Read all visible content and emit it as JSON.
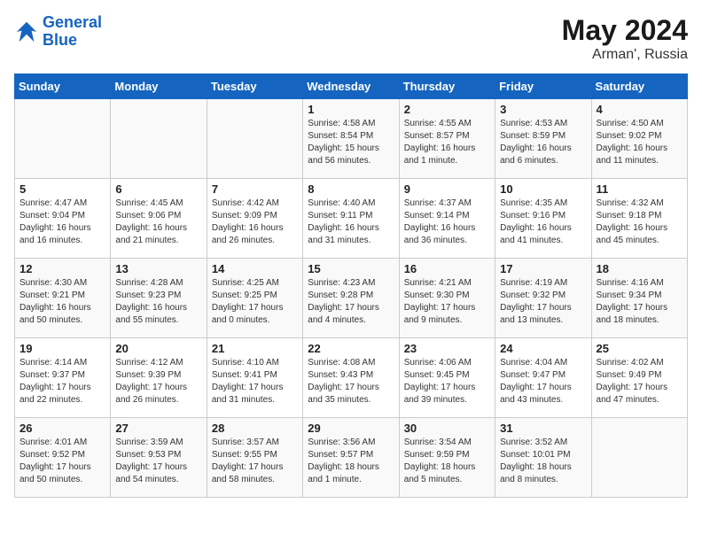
{
  "header": {
    "logo_line1": "General",
    "logo_line2": "Blue",
    "month": "May 2024",
    "location": "Arman', Russia"
  },
  "weekdays": [
    "Sunday",
    "Monday",
    "Tuesday",
    "Wednesday",
    "Thursday",
    "Friday",
    "Saturday"
  ],
  "weeks": [
    [
      {
        "day": "",
        "info": ""
      },
      {
        "day": "",
        "info": ""
      },
      {
        "day": "",
        "info": ""
      },
      {
        "day": "1",
        "info": "Sunrise: 4:58 AM\nSunset: 8:54 PM\nDaylight: 15 hours\nand 56 minutes."
      },
      {
        "day": "2",
        "info": "Sunrise: 4:55 AM\nSunset: 8:57 PM\nDaylight: 16 hours\nand 1 minute."
      },
      {
        "day": "3",
        "info": "Sunrise: 4:53 AM\nSunset: 8:59 PM\nDaylight: 16 hours\nand 6 minutes."
      },
      {
        "day": "4",
        "info": "Sunrise: 4:50 AM\nSunset: 9:02 PM\nDaylight: 16 hours\nand 11 minutes."
      }
    ],
    [
      {
        "day": "5",
        "info": "Sunrise: 4:47 AM\nSunset: 9:04 PM\nDaylight: 16 hours\nand 16 minutes."
      },
      {
        "day": "6",
        "info": "Sunrise: 4:45 AM\nSunset: 9:06 PM\nDaylight: 16 hours\nand 21 minutes."
      },
      {
        "day": "7",
        "info": "Sunrise: 4:42 AM\nSunset: 9:09 PM\nDaylight: 16 hours\nand 26 minutes."
      },
      {
        "day": "8",
        "info": "Sunrise: 4:40 AM\nSunset: 9:11 PM\nDaylight: 16 hours\nand 31 minutes."
      },
      {
        "day": "9",
        "info": "Sunrise: 4:37 AM\nSunset: 9:14 PM\nDaylight: 16 hours\nand 36 minutes."
      },
      {
        "day": "10",
        "info": "Sunrise: 4:35 AM\nSunset: 9:16 PM\nDaylight: 16 hours\nand 41 minutes."
      },
      {
        "day": "11",
        "info": "Sunrise: 4:32 AM\nSunset: 9:18 PM\nDaylight: 16 hours\nand 45 minutes."
      }
    ],
    [
      {
        "day": "12",
        "info": "Sunrise: 4:30 AM\nSunset: 9:21 PM\nDaylight: 16 hours\nand 50 minutes."
      },
      {
        "day": "13",
        "info": "Sunrise: 4:28 AM\nSunset: 9:23 PM\nDaylight: 16 hours\nand 55 minutes."
      },
      {
        "day": "14",
        "info": "Sunrise: 4:25 AM\nSunset: 9:25 PM\nDaylight: 17 hours\nand 0 minutes."
      },
      {
        "day": "15",
        "info": "Sunrise: 4:23 AM\nSunset: 9:28 PM\nDaylight: 17 hours\nand 4 minutes."
      },
      {
        "day": "16",
        "info": "Sunrise: 4:21 AM\nSunset: 9:30 PM\nDaylight: 17 hours\nand 9 minutes."
      },
      {
        "day": "17",
        "info": "Sunrise: 4:19 AM\nSunset: 9:32 PM\nDaylight: 17 hours\nand 13 minutes."
      },
      {
        "day": "18",
        "info": "Sunrise: 4:16 AM\nSunset: 9:34 PM\nDaylight: 17 hours\nand 18 minutes."
      }
    ],
    [
      {
        "day": "19",
        "info": "Sunrise: 4:14 AM\nSunset: 9:37 PM\nDaylight: 17 hours\nand 22 minutes."
      },
      {
        "day": "20",
        "info": "Sunrise: 4:12 AM\nSunset: 9:39 PM\nDaylight: 17 hours\nand 26 minutes."
      },
      {
        "day": "21",
        "info": "Sunrise: 4:10 AM\nSunset: 9:41 PM\nDaylight: 17 hours\nand 31 minutes."
      },
      {
        "day": "22",
        "info": "Sunrise: 4:08 AM\nSunset: 9:43 PM\nDaylight: 17 hours\nand 35 minutes."
      },
      {
        "day": "23",
        "info": "Sunrise: 4:06 AM\nSunset: 9:45 PM\nDaylight: 17 hours\nand 39 minutes."
      },
      {
        "day": "24",
        "info": "Sunrise: 4:04 AM\nSunset: 9:47 PM\nDaylight: 17 hours\nand 43 minutes."
      },
      {
        "day": "25",
        "info": "Sunrise: 4:02 AM\nSunset: 9:49 PM\nDaylight: 17 hours\nand 47 minutes."
      }
    ],
    [
      {
        "day": "26",
        "info": "Sunrise: 4:01 AM\nSunset: 9:52 PM\nDaylight: 17 hours\nand 50 minutes."
      },
      {
        "day": "27",
        "info": "Sunrise: 3:59 AM\nSunset: 9:53 PM\nDaylight: 17 hours\nand 54 minutes."
      },
      {
        "day": "28",
        "info": "Sunrise: 3:57 AM\nSunset: 9:55 PM\nDaylight: 17 hours\nand 58 minutes."
      },
      {
        "day": "29",
        "info": "Sunrise: 3:56 AM\nSunset: 9:57 PM\nDaylight: 18 hours\nand 1 minute."
      },
      {
        "day": "30",
        "info": "Sunrise: 3:54 AM\nSunset: 9:59 PM\nDaylight: 18 hours\nand 5 minutes."
      },
      {
        "day": "31",
        "info": "Sunrise: 3:52 AM\nSunset: 10:01 PM\nDaylight: 18 hours\nand 8 minutes."
      },
      {
        "day": "",
        "info": ""
      }
    ]
  ]
}
